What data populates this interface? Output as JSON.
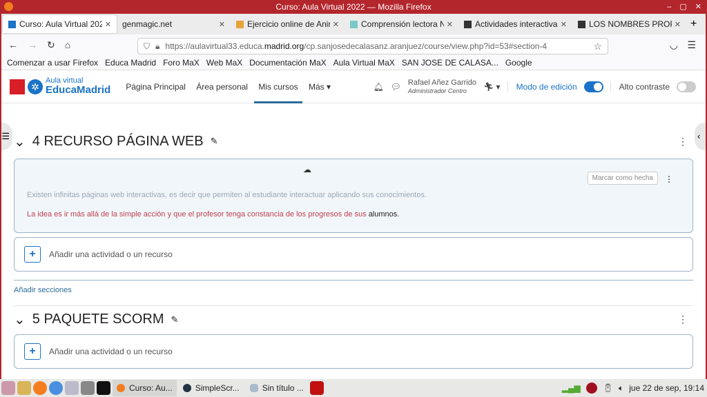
{
  "window": {
    "title": "Curso: Aula Virtual 2022 — Mozilla Firefox",
    "controls": [
      "–",
      "▢",
      "✕"
    ]
  },
  "tabs": [
    {
      "label": "Curso: Aula Virtual 2022",
      "color": "#1a73c7"
    },
    {
      "label": "genmagic.net",
      "color": ""
    },
    {
      "label": "Ejercicio online de Animales",
      "color": "#e9a23b"
    },
    {
      "label": "Comprensión lectora Nº5",
      "color": "#7cc8c8"
    },
    {
      "label": "Actividades interactivas",
      "color": "#333"
    },
    {
      "label": "LOS NOMBRES PROPIOS",
      "color": "#333"
    }
  ],
  "new_tab": "+",
  "url": {
    "prefix": "https://aulavirtual33.educa.",
    "domain": "madrid.org",
    "suffix": "/cp.sanjosedecalasanz.aranjuez/course/view.php?id=53#section-4"
  },
  "bookmarks": [
    "Comenzar a usar Firefox",
    "Educa Madrid",
    "Foro MaX",
    "Web MaX",
    "Documentación MaX",
    "Aula Virtual MaX",
    "SAN JOSE DE CALASA...",
    "Google"
  ],
  "header": {
    "logo_top": "Aula virtual",
    "logo_bottom": "EducaMadrid",
    "menu": [
      "Página Principal",
      "Área personal",
      "Mis cursos",
      "Más"
    ],
    "user_name": "Rafael Añez Garrido",
    "user_role": "Administrador Centro",
    "edit_mode": "Modo de edición",
    "high_contrast": "Alto contraste"
  },
  "sections": [
    {
      "title": "4 RECURSO PÁGINA WEB",
      "completion": "Marcar como hecha",
      "text1": "Existen infinitas páginas web interactivas, es decir que permiten al estudiante interactuar aplicando sus conocimientos.",
      "text2_red": "La idea es ir más allá de la simple acción y que el profesor tenga constancia de los progresos de sus",
      "text2_end": "alumnos.",
      "add": "Añadir una actividad o un recurso"
    },
    {
      "title": "5 PAQUETE SCORM",
      "add": "Añadir una actividad o un recurso"
    }
  ],
  "add_sections": "Añadir secciones",
  "taskbar": {
    "items": [
      "Curso: Au...",
      "SimpleScr...",
      "Sin título ..."
    ],
    "clock": "jue 22 de sep, 19:14"
  }
}
